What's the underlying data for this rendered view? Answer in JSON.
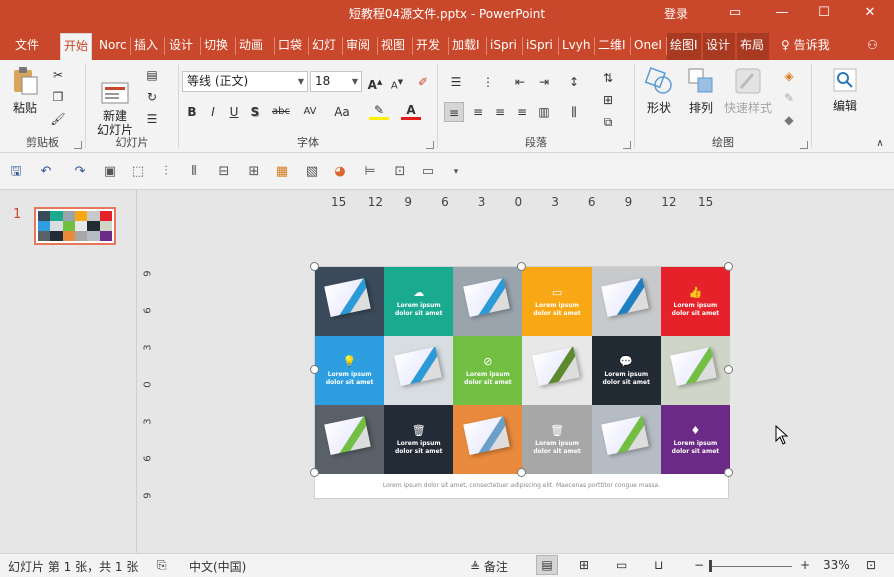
{
  "window": {
    "title": "短教程04源文件.pptx  -  PowerPoint",
    "login": "登录",
    "buttons": {
      "ribbon_options": "▭",
      "minimize": "—",
      "maximize": "☐",
      "close": "✕"
    }
  },
  "tabs": [
    {
      "label": "文件"
    },
    {
      "label": "开始"
    },
    {
      "label": "Norc"
    },
    {
      "label": "插入"
    },
    {
      "label": "设计"
    },
    {
      "label": "切换"
    },
    {
      "label": "动画"
    },
    {
      "label": "口袋"
    },
    {
      "label": "幻灯"
    },
    {
      "label": "审阅"
    },
    {
      "label": "视图"
    },
    {
      "label": "开发"
    },
    {
      "label": "加载I"
    },
    {
      "label": "iSpri"
    },
    {
      "label": "iSpri"
    },
    {
      "label": "Lvyh"
    },
    {
      "label": "二维I"
    },
    {
      "label": "OneI"
    },
    {
      "label": "绘图I"
    },
    {
      "label": "设计"
    },
    {
      "label": "布局"
    }
  ],
  "tell_me": "告诉我",
  "ribbon": {
    "clipboard": {
      "label": "剪贴板",
      "paste": "粘贴"
    },
    "slides": {
      "label": "幻灯片",
      "new_slide": "新建\n幻灯片"
    },
    "font": {
      "label": "字体",
      "family": "等线 (正文)",
      "size": "18",
      "bold": "B",
      "italic": "I",
      "underline": "U",
      "shadow": "S",
      "strike": "abc",
      "spacing": "AV",
      "case": "Aa",
      "grow": "A",
      "shrink": "A"
    },
    "paragraph": {
      "label": "段落"
    },
    "drawing": {
      "label": "绘图",
      "shapes": "形状",
      "arrange": "排列",
      "quick_styles": "快速样式"
    },
    "editing": {
      "label": "编辑",
      "edit": "编辑"
    }
  },
  "thumbnails": {
    "slide_number": "1"
  },
  "ruler": {
    "h": [
      "15",
      "12",
      "9",
      "6",
      "3",
      "0",
      "3",
      "6",
      "9",
      "12",
      "15"
    ],
    "v": [
      "9",
      "6",
      "3",
      "0",
      "3",
      "6",
      "9"
    ]
  },
  "slide": {
    "cells": [
      {
        "kind": "photo",
        "bg": "#3b4a5a",
        "accent": "#2b9ad6"
      },
      {
        "kind": "text",
        "bg": "#1aaa8f",
        "icon": "☁",
        "text": "Lorem ipsum\ndolor sit amet"
      },
      {
        "kind": "photo",
        "bg": "#9aa4ad",
        "accent": "#2b9ad6"
      },
      {
        "kind": "text",
        "bg": "#f7a814",
        "icon": "▭",
        "text": "Lorem ipsum\ndolor sit amet"
      },
      {
        "kind": "photo",
        "bg": "#c7c9cb",
        "accent": "#1f7fc0"
      },
      {
        "kind": "text",
        "bg": "#e52129",
        "icon": "👍",
        "text": "Lorem ipsum\ndolor sit amet"
      },
      {
        "kind": "text",
        "bg": "#2d9fe0",
        "icon": "💡",
        "text": "Lorem ipsum\ndolor sit amet"
      },
      {
        "kind": "photo",
        "bg": "#d8dde2",
        "accent": "#2b9ad6"
      },
      {
        "kind": "text",
        "bg": "#72bf44",
        "icon": "⊘",
        "text": "Lorem ipsum\ndolor sit amet"
      },
      {
        "kind": "photo",
        "bg": "#e8e8e8",
        "accent": "#5d8a2e"
      },
      {
        "kind": "text",
        "bg": "#222a34",
        "icon": "💬",
        "text": "Lorem ipsum\ndolor sit amet"
      },
      {
        "kind": "photo",
        "bg": "#cfd6c8",
        "accent": "#72bf44"
      },
      {
        "kind": "photo",
        "bg": "#5a6068",
        "accent": "#72bf44"
      },
      {
        "kind": "text",
        "bg": "#232b36",
        "icon": "🗑",
        "text": "Lorem ipsum\ndolor sit amet"
      },
      {
        "kind": "photo",
        "bg": "#e98a3c",
        "accent": "#6aa0c8"
      },
      {
        "kind": "text",
        "bg": "#a7a7a7",
        "icon": "🗑",
        "text": "Lorem ipsum\ndolor sit amet"
      },
      {
        "kind": "photo",
        "bg": "#b6bcc4",
        "accent": "#72bf44"
      },
      {
        "kind": "text",
        "bg": "#6b2a86",
        "icon": "♦",
        "text": "Lorem ipsum\ndolor sit amet"
      }
    ],
    "caption": "Lorem ipsum dolor sit amet, consectetuer adipiscing elit. Maecenas porttitor congue massa."
  },
  "status": {
    "slide_info": "幻灯片 第 1 张，共 1 张",
    "language": "中文(中国)",
    "notes": "备注",
    "zoom": "33%",
    "zoom_minus": "−",
    "zoom_plus": "+"
  },
  "colors": {
    "accent": "#c9472a",
    "selected_thumb_border": "#e8765a"
  }
}
